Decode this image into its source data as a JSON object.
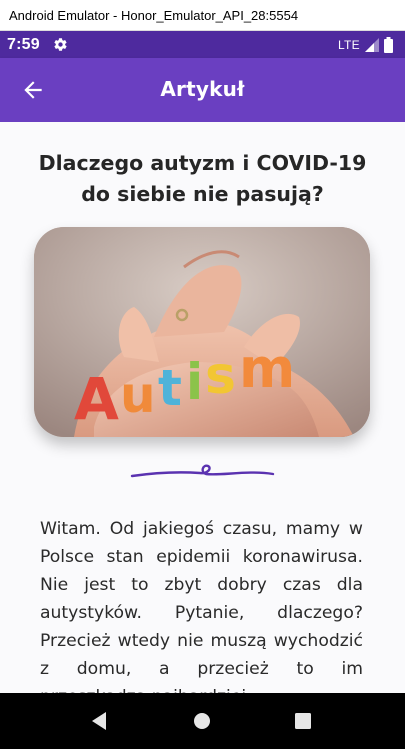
{
  "window": {
    "title": "Android Emulator - Honor_Emulator_API_28:5554"
  },
  "status_bar": {
    "time": "7:59",
    "network": "LTE",
    "icons": [
      "gear-icon",
      "signal-icon",
      "battery-icon"
    ]
  },
  "app_bar": {
    "title": "Artykuł",
    "back_icon": "arrow-back-icon"
  },
  "article": {
    "title": "Dlaczego autyzm i COVID-19 do siebie nie pasują?",
    "image_text": "Autism",
    "body": "Witam. Od jakiegoś czasu, mamy w Polsce stan epidemii koronawirusa. Nie jest to zbyt dobry czas dla autystyków. Pytanie, dlaczego? Przecież wtedy nie muszą wychodzić z domu, a przecież to im przeszkadza najbardziej."
  },
  "nav_bar": {
    "buttons": [
      "back-triangle-icon",
      "home-circle-icon",
      "overview-square-icon"
    ]
  },
  "colors": {
    "status_bar": "#4e2a9e",
    "app_bar": "#6a3fc1",
    "accent": "#5a32b0"
  }
}
